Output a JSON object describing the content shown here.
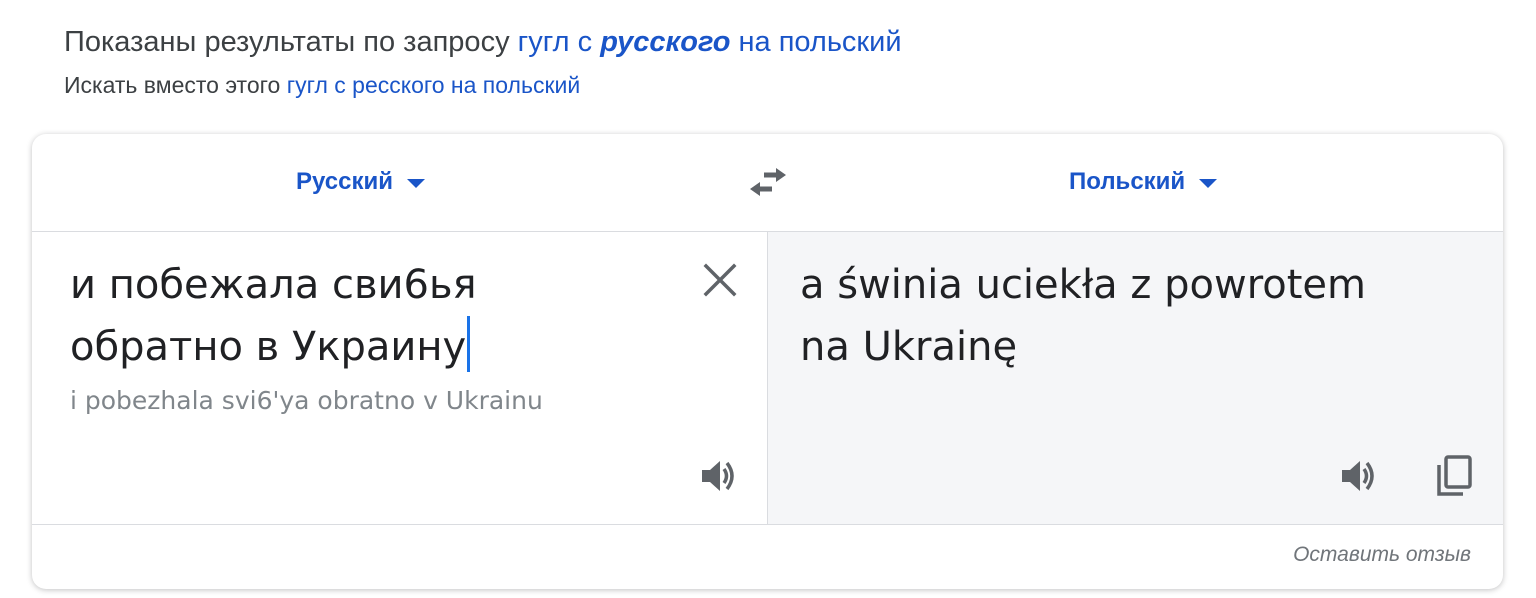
{
  "spelling": {
    "shown_prefix": "Показаны результаты по запросу",
    "shown_query_part1": "гугл с",
    "shown_query_corrected": "русского",
    "shown_query_part2": "на польский",
    "instead_prefix": "Искать вместо этого",
    "instead_query": "гугл с ресского на польский"
  },
  "translator": {
    "source_language": "Русский",
    "target_language": "Польский",
    "source_text_line1": "и побежала сви6ья",
    "source_text_line2": "обратно в Украину",
    "transliteration": "i pobezhala svi6'ya obratno v Ukrainu",
    "target_text_line1": "a świnia uciekła z powrotem",
    "target_text_line2": "na Ukrainę",
    "feedback_label": "Оставить отзыв"
  },
  "icons": {
    "swap": "swap-arrows-icon",
    "clear": "close-icon",
    "speak": "speaker-icon",
    "copy": "copy-icon"
  },
  "colors": {
    "link": "#1a55c8",
    "cursor": "#1a73e8",
    "target_panel_bg": "#f5f6f8"
  }
}
